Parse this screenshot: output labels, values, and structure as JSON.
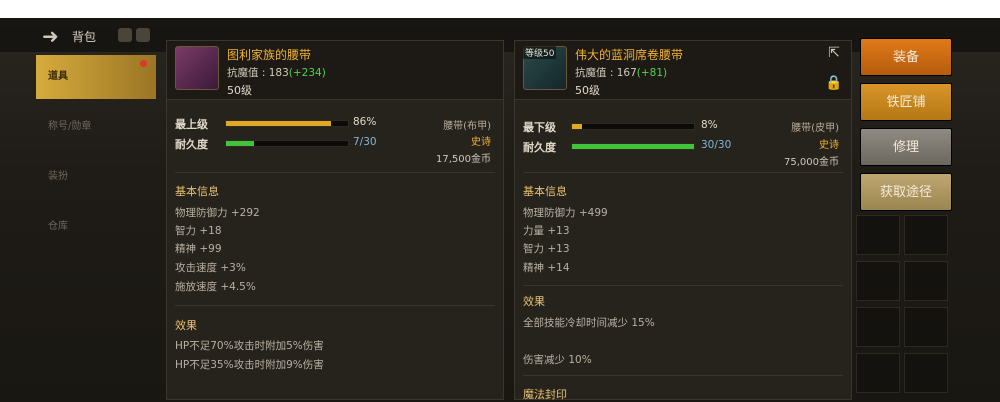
{
  "topbar": {
    "title": "背包"
  },
  "sidebar": {
    "items": [
      {
        "label": "道具"
      },
      {
        "label": "称号/勋章"
      },
      {
        "label": "装扮"
      },
      {
        "label": "仓库"
      }
    ]
  },
  "panel_left": {
    "item_level_tag": "",
    "name": "图利家族的腰带",
    "resist_label": "抗魔值 : 183",
    "resist_bonus": "(+234)",
    "level": "50级",
    "quality_label": "最上级",
    "quality_pct": "86%",
    "quality_value": 0.86,
    "durability_label": "耐久度",
    "durability_text": "7/30",
    "durability_value": 0.2333,
    "type": "腰带(布甲)",
    "rarity": "史诗",
    "price": "17,500金币",
    "basic_title": "基本信息",
    "stats": [
      "物理防御力 +292",
      "智力 +18",
      "精神 +99",
      "攻击速度 +3%",
      "施放速度 +4.5%"
    ],
    "effect_title": "效果",
    "effects": [
      "HP不足70%攻击时附加5%伤害",
      "HP不足35%攻击时附加9%伤害"
    ]
  },
  "panel_right": {
    "item_level_tag": "等级50",
    "name": "伟大的蓝洞席卷腰带",
    "resist_label": "抗魔值 : 167",
    "resist_bonus": "(+81)",
    "level": "50级",
    "quality_label": "最下级",
    "quality_pct": "8%",
    "quality_value": 0.08,
    "durability_label": "耐久度",
    "durability_text": "30/30",
    "durability_value": 1.0,
    "type": "腰带(皮甲)",
    "rarity": "史诗",
    "price": "75,000金币",
    "basic_title": "基本信息",
    "stats": [
      "物理防御力 +499",
      "力量 +13",
      "智力 +13",
      "精神 +14"
    ],
    "effect_title": "效果",
    "effects": [
      "全部技能冷却时间减少 15%",
      "伤害减少 10%"
    ],
    "seal_title": "魔法封印"
  },
  "buttons": {
    "equip": "装备",
    "blacksmith": "铁匠铺",
    "repair": "修理",
    "obtain": "获取途径"
  },
  "colors": {
    "quality_bar": "#e3a823",
    "durability_bar": "#3fc43a",
    "item_name": "#f0b232"
  }
}
